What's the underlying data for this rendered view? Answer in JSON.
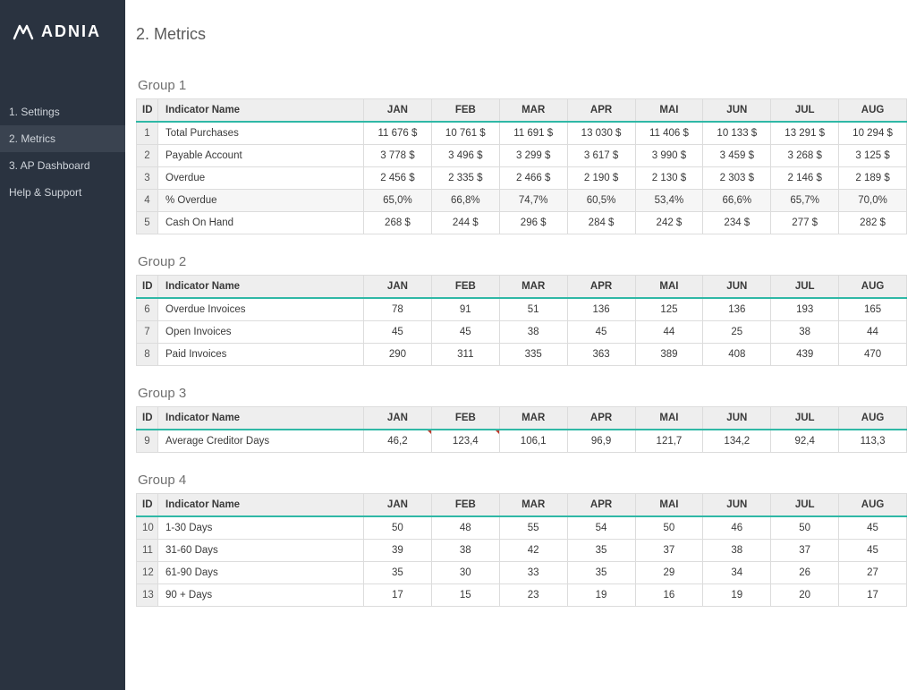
{
  "brand": "ADNIA",
  "page_title": "2. Metrics",
  "nav": [
    {
      "label": "1. Settings",
      "active": false
    },
    {
      "label": "2. Metrics",
      "active": true
    },
    {
      "label": "3. AP Dashboard",
      "active": false
    },
    {
      "label": "Help & Support",
      "active": false
    }
  ],
  "months": [
    "JAN",
    "FEB",
    "MAR",
    "APR",
    "MAI",
    "JUN",
    "JUL",
    "AUG"
  ],
  "headers": {
    "id": "ID",
    "name": "Indicator Name"
  },
  "groups": [
    {
      "title": "Group 1",
      "rows": [
        {
          "id": 1,
          "name": "Total Purchases",
          "shaded": false,
          "vals": [
            "11 676 $",
            "10 761 $",
            "11 691 $",
            "13 030 $",
            "11 406 $",
            "10 133 $",
            "13 291 $",
            "10 294 $"
          ]
        },
        {
          "id": 2,
          "name": "Payable Account",
          "shaded": false,
          "vals": [
            "3 778 $",
            "3 496 $",
            "3 299 $",
            "3 617 $",
            "3 990 $",
            "3 459 $",
            "3 268 $",
            "3 125 $"
          ]
        },
        {
          "id": 3,
          "name": "Overdue",
          "shaded": false,
          "vals": [
            "2 456 $",
            "2 335 $",
            "2 466 $",
            "2 190 $",
            "2 130 $",
            "2 303 $",
            "2 146 $",
            "2 189 $"
          ]
        },
        {
          "id": 4,
          "name": "% Overdue",
          "shaded": true,
          "vals": [
            "65,0%",
            "66,8%",
            "74,7%",
            "60,5%",
            "53,4%",
            "66,6%",
            "65,7%",
            "70,0%"
          ]
        },
        {
          "id": 5,
          "name": "Cash On Hand",
          "shaded": false,
          "vals": [
            "268 $",
            "244 $",
            "296 $",
            "284 $",
            "242 $",
            "234 $",
            "277 $",
            "282 $"
          ]
        }
      ],
      "triangles": []
    },
    {
      "title": "Group 2",
      "rows": [
        {
          "id": 6,
          "name": "Overdue Invoices",
          "shaded": false,
          "vals": [
            "78",
            "91",
            "51",
            "136",
            "125",
            "136",
            "193",
            "165"
          ]
        },
        {
          "id": 7,
          "name": "Open Invoices",
          "shaded": false,
          "vals": [
            "45",
            "45",
            "38",
            "45",
            "44",
            "25",
            "38",
            "44"
          ]
        },
        {
          "id": 8,
          "name": "Paid Invoices",
          "shaded": false,
          "vals": [
            "290",
            "311",
            "335",
            "363",
            "389",
            "408",
            "439",
            "470"
          ]
        }
      ],
      "triangles": []
    },
    {
      "title": "Group 3",
      "rows": [
        {
          "id": 9,
          "name": "Average Creditor Days",
          "shaded": false,
          "vals": [
            "46,2",
            "123,4",
            "106,1",
            "96,9",
            "121,7",
            "134,2",
            "92,4",
            "113,3"
          ]
        }
      ],
      "triangles": [
        [
          0,
          0
        ],
        [
          0,
          1
        ]
      ]
    },
    {
      "title": "Group 4",
      "rows": [
        {
          "id": 10,
          "name": "1-30 Days",
          "shaded": false,
          "vals": [
            "50",
            "48",
            "55",
            "54",
            "50",
            "46",
            "50",
            "45"
          ]
        },
        {
          "id": 11,
          "name": "31-60 Days",
          "shaded": false,
          "vals": [
            "39",
            "38",
            "42",
            "35",
            "37",
            "38",
            "37",
            "45"
          ]
        },
        {
          "id": 12,
          "name": "61-90 Days",
          "shaded": false,
          "vals": [
            "35",
            "30",
            "33",
            "35",
            "29",
            "34",
            "26",
            "27"
          ]
        },
        {
          "id": 13,
          "name": "90 + Days",
          "shaded": false,
          "vals": [
            "17",
            "15",
            "23",
            "19",
            "16",
            "19",
            "20",
            "17"
          ]
        }
      ],
      "triangles": []
    }
  ]
}
